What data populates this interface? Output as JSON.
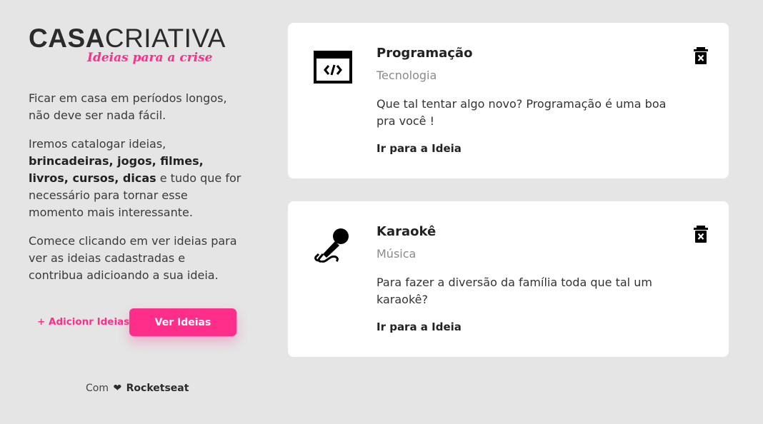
{
  "logo": {
    "casa": "CASA",
    "criativa": "CRIATIVA",
    "tagline": "Ideias para a crise"
  },
  "intro": {
    "p1": "Ficar em casa em períodos longos, não deve ser nada fácil.",
    "p2_start": "Iremos catalogar ideias, ",
    "p2_bold": "brincadeiras, jogos, filmes, livros, cursos, dicas",
    "p2_end": " e tudo que for necessário para tornar esse momento mais interessante.",
    "p3": "Comece clicando em ver ideias para ver as ideias cadastradas e contribua adicioando a sua ideia."
  },
  "actions": {
    "add_label": "+ Adicionr Ideias",
    "view_label": "Ver Ideias"
  },
  "footer": {
    "prefix": "Com",
    "heart": "❤",
    "brand": "Rocketseat"
  },
  "ideas": [
    {
      "title": "Programação",
      "category": "Tecnologia",
      "description": "Que tal tentar algo novo? Programação é uma boa pra você !",
      "link": "Ir para a Ideia",
      "icon": "code-window-icon"
    },
    {
      "title": "Karaokê",
      "category": "Música",
      "description": "Para fazer a diversão da família toda que tal um karaokê?",
      "link": "Ir para a Ideia",
      "icon": "microphone-icon"
    }
  ],
  "colors": {
    "accent": "#ff2e8b",
    "background": "#e5e5e5",
    "card": "#ffffff"
  }
}
